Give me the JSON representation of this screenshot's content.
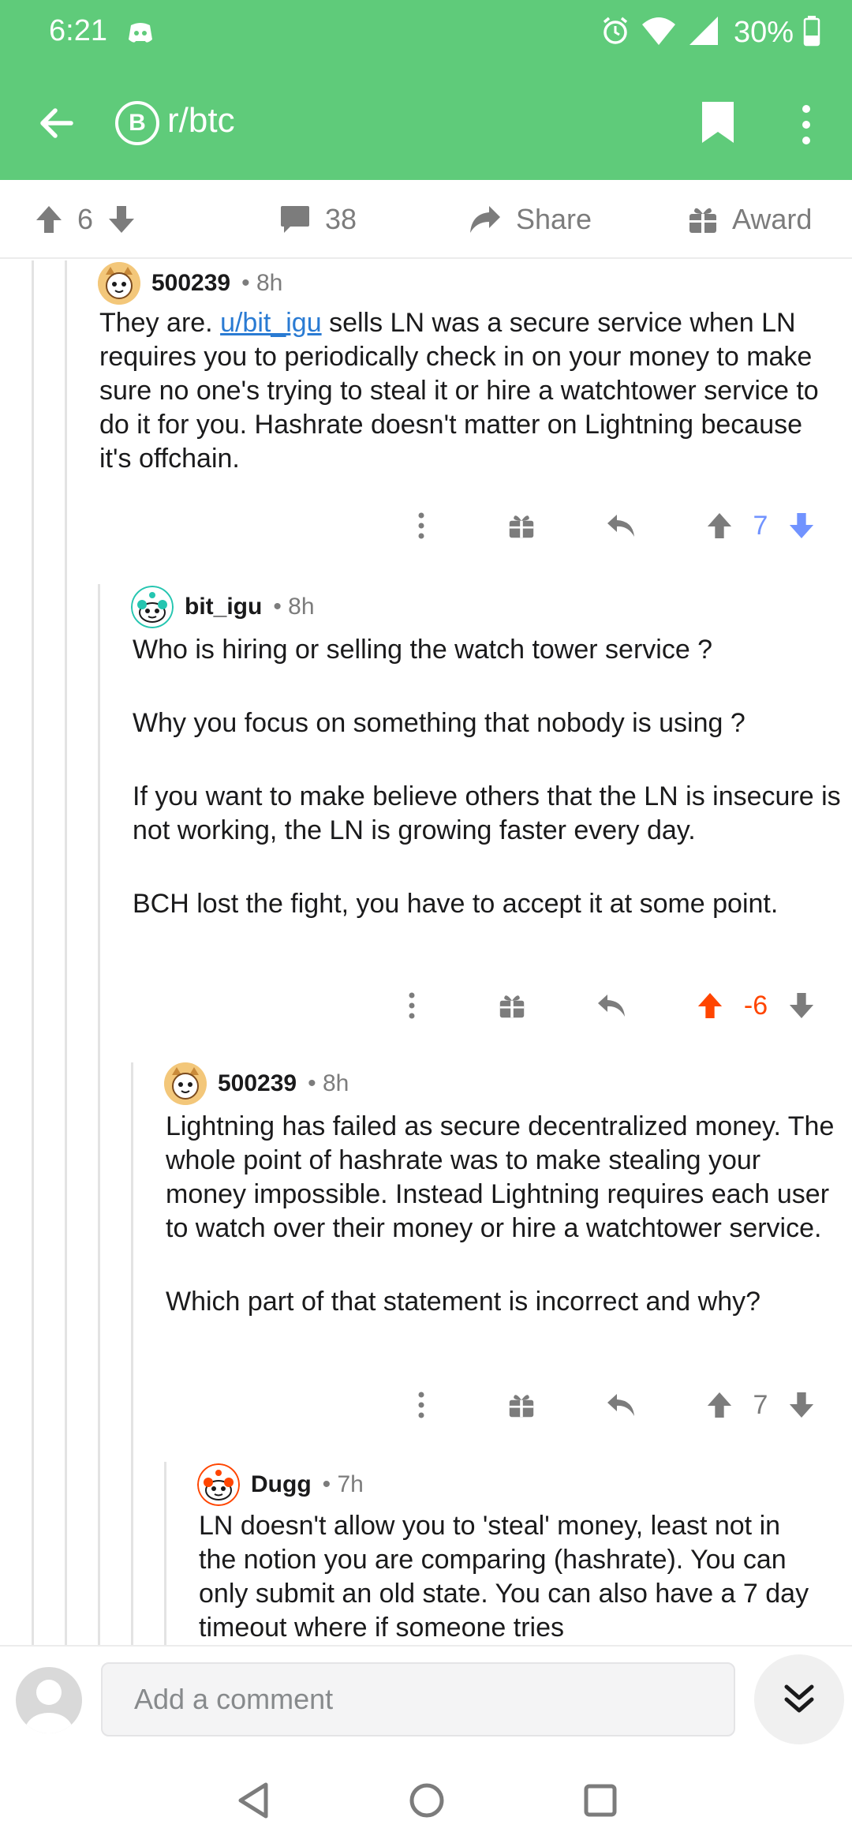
{
  "status_bar": {
    "time": "6:21",
    "battery": "30%",
    "icons": [
      "discord-icon",
      "alarm-icon",
      "wifi-icon",
      "signal-icon",
      "battery-icon"
    ]
  },
  "app_bar": {
    "subreddit": "r/btc",
    "subreddit_icon_letter": "B",
    "icons": [
      "back-arrow-icon",
      "bookmark-icon",
      "more-vert-icon"
    ]
  },
  "post_actions": {
    "score": "6",
    "comments": "38",
    "share_label": "Share",
    "award_label": "Award"
  },
  "comments": [
    {
      "username": "500239",
      "age": "8h",
      "avatar": "cat-avatar-icon",
      "mention": "u/bit_igu",
      "body_intro": "They are. ",
      "body_rest": " sells LN was a secure service when LN requires you to periodically check in on your money to make sure no one's trying to steal it or hire a watchtower service to do it for you. Hashrate doesn't matter on Lightning because it's offchain.",
      "score": "7",
      "vote_state": "downvoted"
    },
    {
      "username": "bit_igu",
      "age": "8h",
      "avatar": "snoo-avatar-icon",
      "paragraphs": [
        "Who is hiring or selling the watch tower service ?",
        "Why you focus on something that nobody is using ?",
        "If you want to make believe others that the LN is insecure is not working, the LN is growing faster every day.",
        "BCH lost the fight, you have to accept it at some point."
      ],
      "score": "-6",
      "vote_state": "upvoted"
    },
    {
      "username": "500239",
      "age": "8h",
      "avatar": "cat-avatar-icon",
      "paragraphs": [
        "Lightning has failed as secure decentralized money. The whole point of hashrate was to make stealing your money impossible. Instead Lightning requires each user to watch over their money or hire a watchtower service.",
        "Which part of that statement is incorrect and why?"
      ],
      "score": "7",
      "vote_state": "none"
    },
    {
      "username": "Dugg",
      "age": "7h",
      "avatar": "snoo-avatar-icon",
      "paragraphs": [
        "LN doesn't allow you to 'steal' money, least not in the notion you are comparing (hashrate). You can only submit an old state. You can also have a 7 day timeout where if someone tries"
      ]
    }
  ],
  "composer": {
    "placeholder": "Add a comment"
  },
  "colors": {
    "brand_green": "#5fcb7a",
    "upvote_orange": "#ff4500",
    "downvote_blue": "#7193ff",
    "link_blue": "#2a7bd3"
  }
}
